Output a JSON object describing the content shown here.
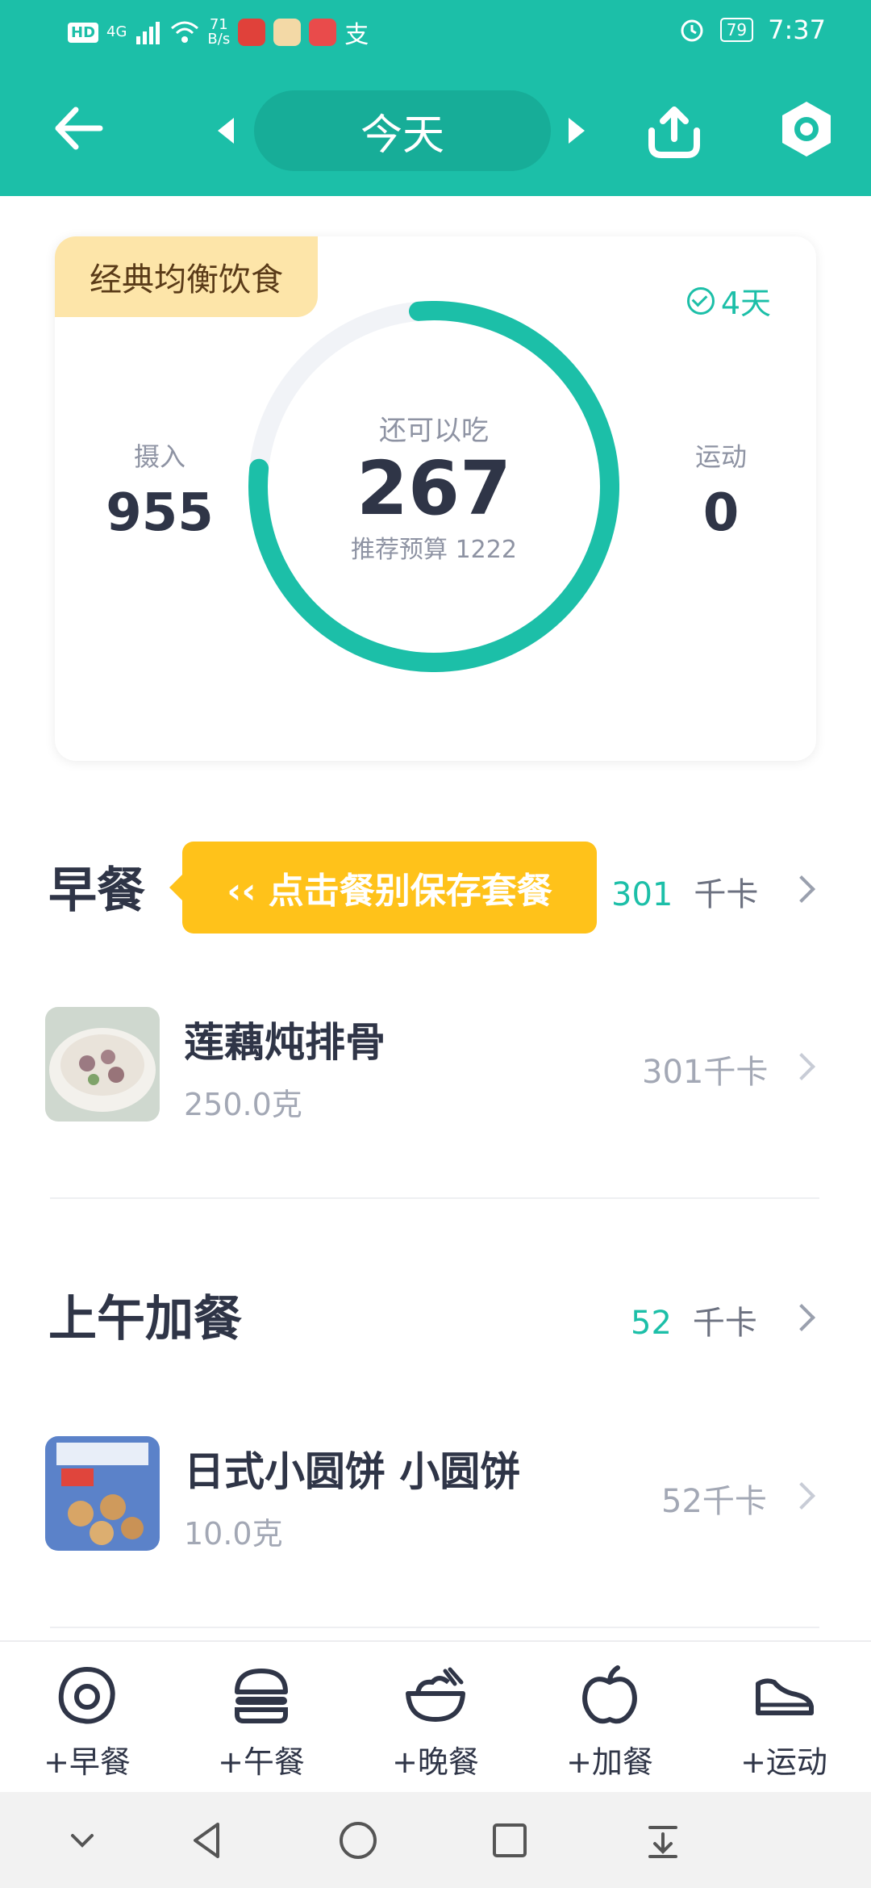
{
  "status_bar": {
    "net_badge": "HD",
    "net_type": "4G",
    "speed_value": "71",
    "speed_unit": "B/s",
    "battery": "79",
    "time": "7:37"
  },
  "header": {
    "day_label": "今天"
  },
  "summary": {
    "plan_name": "经典均衡饮食",
    "streak": "4天",
    "intake_label": "摄入",
    "intake_value": "955",
    "remaining_label": "还可以吃",
    "remaining_value": "267",
    "budget_text": "推荐预算 1222",
    "exercise_label": "运动",
    "exercise_value": "0",
    "progress_fraction": 0.78
  },
  "meals": [
    {
      "title": "早餐",
      "kcal": "301",
      "unit": "千卡",
      "tip": "‹‹ 点击餐别保存套餐",
      "items": [
        {
          "name": "莲藕炖排骨",
          "weight": "250.0克",
          "kcal": "301千卡"
        }
      ]
    },
    {
      "title": "上午加餐",
      "kcal": "52",
      "unit": "千卡",
      "items": [
        {
          "name": "日式小圆饼 小圆饼",
          "weight": "10.0克",
          "kcal": "52千卡"
        }
      ]
    }
  ],
  "bottom_bar": [
    {
      "label": "+早餐",
      "icon": "egg-icon"
    },
    {
      "label": "+午餐",
      "icon": "burger-icon"
    },
    {
      "label": "+晚餐",
      "icon": "bowl-icon"
    },
    {
      "label": "+加餐",
      "icon": "apple-icon"
    },
    {
      "label": "+运动",
      "icon": "shoe-icon"
    }
  ],
  "colors": {
    "brand": "#1cbfa8",
    "tip": "#ffc21a",
    "plan_tag": "#fde5a9"
  }
}
